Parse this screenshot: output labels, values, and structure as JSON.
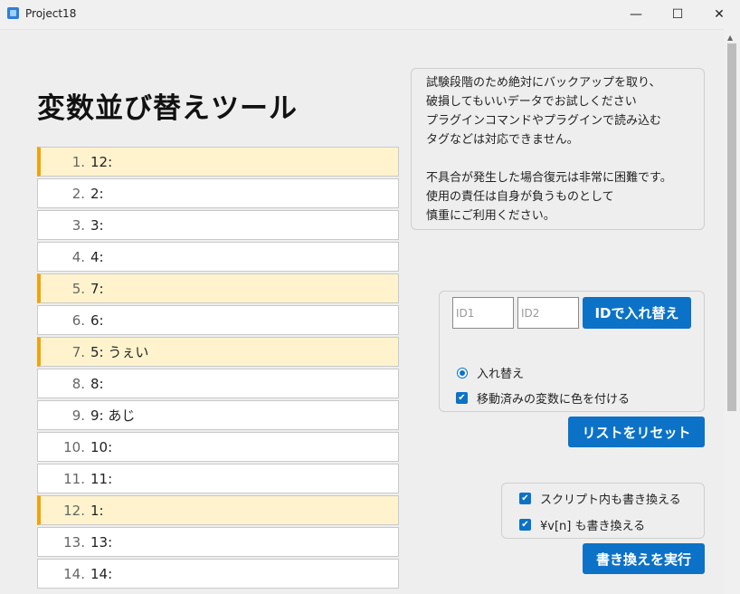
{
  "window": {
    "title": "Project18",
    "minimize": "—",
    "maximize": "☐",
    "close": "✕"
  },
  "page_title": "変数並び替えツール",
  "list": [
    {
      "num": "1.",
      "text": "12:",
      "moved": true
    },
    {
      "num": "2.",
      "text": "2:",
      "moved": false
    },
    {
      "num": "3.",
      "text": "3:",
      "moved": false
    },
    {
      "num": "4.",
      "text": "4:",
      "moved": false
    },
    {
      "num": "5.",
      "text": "7:",
      "moved": true
    },
    {
      "num": "6.",
      "text": "6:",
      "moved": false
    },
    {
      "num": "7.",
      "text": "5: うぇい",
      "moved": true
    },
    {
      "num": "8.",
      "text": "8:",
      "moved": false
    },
    {
      "num": "9.",
      "text": "9: あじ",
      "moved": false
    },
    {
      "num": "10.",
      "text": "10:",
      "moved": false
    },
    {
      "num": "11.",
      "text": "11:",
      "moved": false
    },
    {
      "num": "12.",
      "text": "1:",
      "moved": true
    },
    {
      "num": "13.",
      "text": "13:",
      "moved": false
    },
    {
      "num": "14.",
      "text": "14:",
      "moved": false
    }
  ],
  "notice": {
    "lines": [
      "試験段階のため絶対にバックアップを取り、",
      "破損してもいいデータでお試しください",
      "プラグインコマンドやプラグインで読み込む",
      "タグなどは対応できません。",
      "",
      "不具合が発生した場合復元は非常に困難です。",
      "使用の責任は自身が負うものとして",
      "慎重にご利用ください。"
    ]
  },
  "swap": {
    "id1_placeholder": "ID1",
    "id2_placeholder": "ID2",
    "swap_button": "IDで入れ替え",
    "radio_swap": "入れ替え",
    "check_color": "移動済みの変数に色を付ける"
  },
  "reset_button": "リストをリセット",
  "rewrite": {
    "check_script": "スクリプト内も書き換える",
    "check_v": "¥v[n] も書き換える",
    "execute_button": "書き換えを実行"
  },
  "colors": {
    "accent": "#0b72c7",
    "moved_bg": "#fff3cd",
    "moved_border": "#f0a30a"
  }
}
